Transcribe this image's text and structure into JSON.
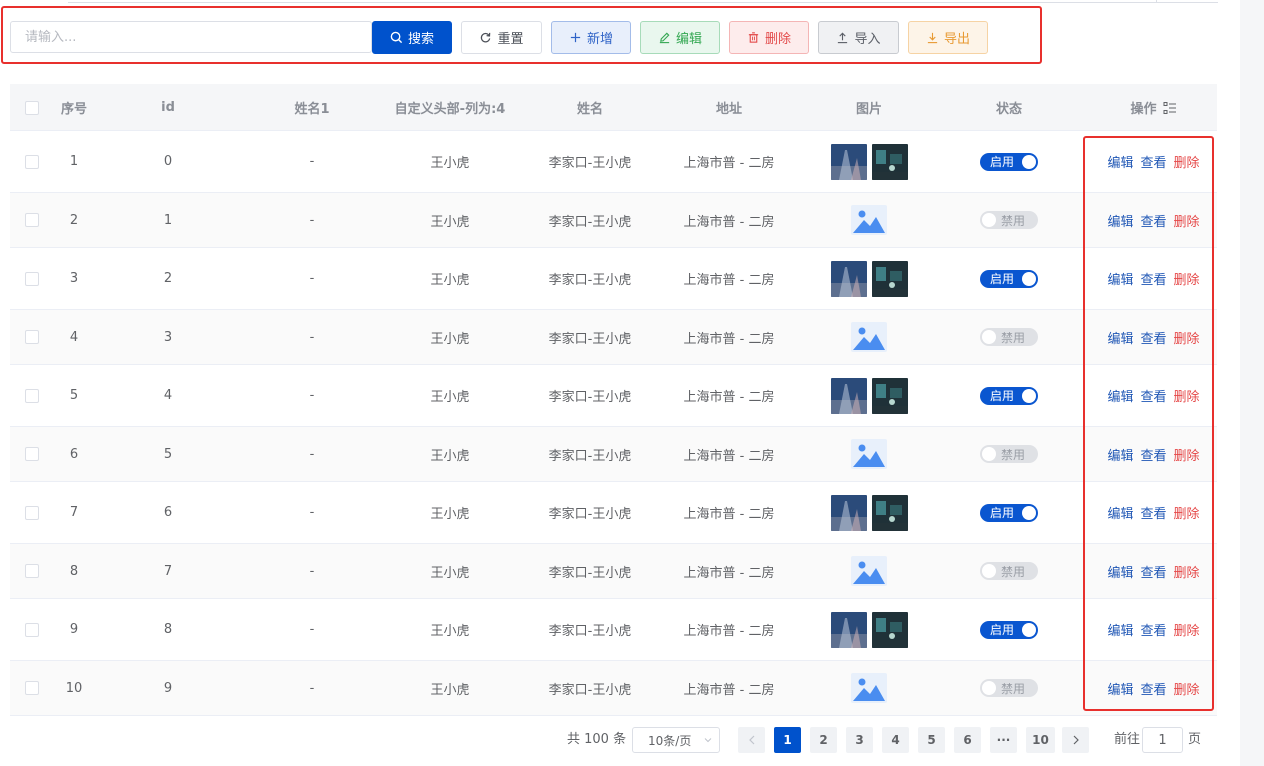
{
  "colors": {
    "primary": "#0052cc",
    "success": "#34a853",
    "danger": "#e54646",
    "warning": "#e89a33",
    "annotation": "#e8302d"
  },
  "toolbar": {
    "search_placeholder": "请输入...",
    "search_label": "搜索",
    "reset_label": "重置",
    "add_label": "新增",
    "edit_label": "编辑",
    "delete_label": "删除",
    "import_label": "导入",
    "export_label": "导出"
  },
  "table": {
    "columns": [
      "序号",
      "id",
      "姓名1",
      "自定义头部-列为:4",
      "姓名",
      "地址",
      "图片",
      "状态",
      "操作"
    ],
    "rows": [
      {
        "index": "1",
        "id": "0",
        "name1": "-",
        "custom": "王小虎",
        "name": "李家口-王小虎",
        "address": "上海市普 - 二房",
        "has_photo": true,
        "status": "启用",
        "enabled": true
      },
      {
        "index": "2",
        "id": "1",
        "name1": "-",
        "custom": "王小虎",
        "name": "李家口-王小虎",
        "address": "上海市普 - 二房",
        "has_photo": false,
        "status": "禁用",
        "enabled": false
      },
      {
        "index": "3",
        "id": "2",
        "name1": "-",
        "custom": "王小虎",
        "name": "李家口-王小虎",
        "address": "上海市普 - 二房",
        "has_photo": true,
        "status": "启用",
        "enabled": true
      },
      {
        "index": "4",
        "id": "3",
        "name1": "-",
        "custom": "王小虎",
        "name": "李家口-王小虎",
        "address": "上海市普 - 二房",
        "has_photo": false,
        "status": "禁用",
        "enabled": false
      },
      {
        "index": "5",
        "id": "4",
        "name1": "-",
        "custom": "王小虎",
        "name": "李家口-王小虎",
        "address": "上海市普 - 二房",
        "has_photo": true,
        "status": "启用",
        "enabled": true
      },
      {
        "index": "6",
        "id": "5",
        "name1": "-",
        "custom": "王小虎",
        "name": "李家口-王小虎",
        "address": "上海市普 - 二房",
        "has_photo": false,
        "status": "禁用",
        "enabled": false
      },
      {
        "index": "7",
        "id": "6",
        "name1": "-",
        "custom": "王小虎",
        "name": "李家口-王小虎",
        "address": "上海市普 - 二房",
        "has_photo": true,
        "status": "启用",
        "enabled": true
      },
      {
        "index": "8",
        "id": "7",
        "name1": "-",
        "custom": "王小虎",
        "name": "李家口-王小虎",
        "address": "上海市普 - 二房",
        "has_photo": false,
        "status": "禁用",
        "enabled": false
      },
      {
        "index": "9",
        "id": "8",
        "name1": "-",
        "custom": "王小虎",
        "name": "李家口-王小虎",
        "address": "上海市普 - 二房",
        "has_photo": true,
        "status": "启用",
        "enabled": true
      },
      {
        "index": "10",
        "id": "9",
        "name1": "-",
        "custom": "王小虎",
        "name": "李家口-王小虎",
        "address": "上海市普 - 二房",
        "has_photo": false,
        "status": "禁用",
        "enabled": false
      }
    ],
    "actions": {
      "edit": "编辑",
      "view": "查看",
      "delete": "删除"
    },
    "column_settings_icon": "list-settings-icon"
  },
  "pagination": {
    "total_text": "共 100 条",
    "page_size": "10条/页",
    "pages": [
      "1",
      "2",
      "3",
      "4",
      "5",
      "6",
      "···",
      "10"
    ],
    "current_page": "1",
    "goto_label": "前往",
    "goto_value": "1",
    "page_unit": "页"
  }
}
